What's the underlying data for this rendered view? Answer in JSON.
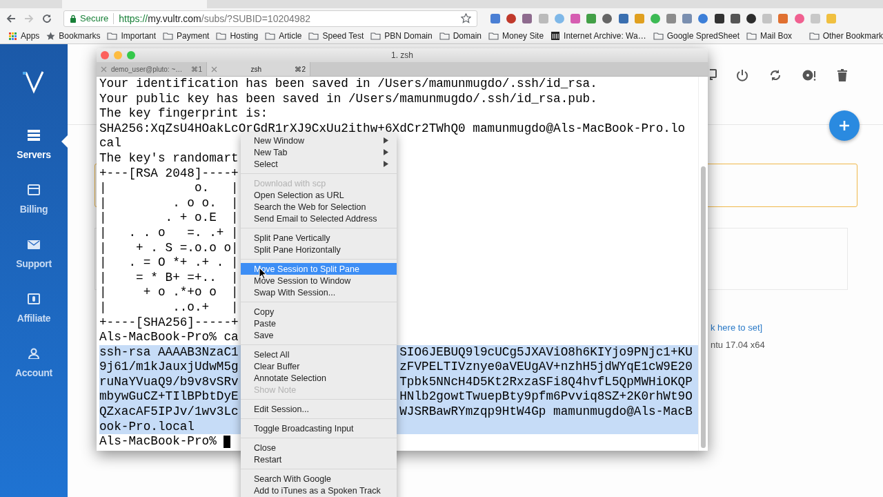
{
  "browser": {
    "address_bar": {
      "security_label": "Secure",
      "url_scheme": "https://",
      "url_host": "my.vultr.com",
      "url_path": "/subs/?SUBID=10204982"
    },
    "bookmarks": [
      {
        "label": "Apps",
        "kind": "apps"
      },
      {
        "label": "Bookmarks",
        "kind": "star"
      },
      {
        "label": "Important",
        "kind": "folder"
      },
      {
        "label": "Payment",
        "kind": "folder"
      },
      {
        "label": "Hosting",
        "kind": "folder"
      },
      {
        "label": "Article",
        "kind": "folder"
      },
      {
        "label": "Speed Test",
        "kind": "folder"
      },
      {
        "label": "PBN Domain",
        "kind": "folder"
      },
      {
        "label": "Domain",
        "kind": "folder"
      },
      {
        "label": "Money Site",
        "kind": "folder"
      },
      {
        "label": "Internet Archive: Wa…",
        "kind": "archive"
      },
      {
        "label": "Google SpredSheet",
        "kind": "folder"
      },
      {
        "label": "Mail Box",
        "kind": "folder"
      }
    ],
    "other_bookmarks": "Other Bookmark"
  },
  "sidebar": {
    "items": [
      {
        "label": "Servers",
        "kind": "servers",
        "selected": true
      },
      {
        "label": "Billing",
        "kind": "billing",
        "selected": false
      },
      {
        "label": "Support",
        "kind": "support",
        "selected": false
      },
      {
        "label": "Affiliate",
        "kind": "affiliate",
        "selected": false
      },
      {
        "label": "Account",
        "kind": "account",
        "selected": false
      }
    ]
  },
  "page": {
    "link_text": "k here to set]",
    "os_text": "ntu 17.04 x64"
  },
  "terminal": {
    "title": "1. zsh",
    "tabs": [
      {
        "label": "demo_user@pluto: ~…",
        "shortcut": "⌘1",
        "selected": false
      },
      {
        "label": "zsh",
        "shortcut": "⌘2",
        "selected": true
      }
    ],
    "lines": [
      {
        "text": "Your identification has been saved in /Users/mamunmugdo/.ssh/id_rsa.",
        "selected": false
      },
      {
        "text": "Your public key has been saved in /Users/mamunmugdo/.ssh/id_rsa.pub.",
        "selected": false
      },
      {
        "text": "The key fingerprint is:",
        "selected": false
      },
      {
        "text": "SHA256:XqZsU4HOakLcOrGdR1rXJ9CxUu2ithw+6XdCr2TWhQ0 mamunmugdo@Als-MacBook-Pro.lo",
        "selected": false
      },
      {
        "text": "cal",
        "selected": false
      },
      {
        "text": "The key's randomart",
        "selected": false
      },
      {
        "text": "+---[RSA 2048]----+",
        "selected": false
      },
      {
        "text": "|            o.   |",
        "selected": false
      },
      {
        "text": "|         . o o.  |",
        "selected": false
      },
      {
        "text": "|        . + o.E  |",
        "selected": false
      },
      {
        "text": "|   . . o   =. .+ |",
        "selected": false
      },
      {
        "text": "|    + . S =.o.o o|",
        "selected": false
      },
      {
        "text": "|   . = O *+ .+ . |",
        "selected": false
      },
      {
        "text": "|    = * B+ =+..  |",
        "selected": false
      },
      {
        "text": "|     + o .*+o o  |",
        "selected": false
      },
      {
        "text": "|         ..o.+   |",
        "selected": false
      },
      {
        "text": "+----[SHA256]-----+",
        "selected": false
      },
      {
        "text": "Als-MacBook-Pro% ca",
        "selected": false
      },
      {
        "text": "ssh-rsa AAAAB3NzaC1",
        "right": "SIO6JEBUQ9l9cUCg5JXAViO8h6KIYjo9PNjc1+KU",
        "selected": true
      },
      {
        "text": "9j61/m1kJauxjUdwM5g",
        "right": "zFVPELTIVznye0aVEUgAV+nzhH5jdWYqE1cW9E20",
        "selected": true
      },
      {
        "text": "ruNaYVuaQ9/b9v8vSRv",
        "right": "Tpbk5NNcH4D5Kt2RxzaSFi8Q4hvfL5QpMWHiOKQP",
        "selected": true
      },
      {
        "text": "mbywGuCZ+TIlBPbtDyE",
        "right": "HNlb2gowtTwuepBty9pfm6Pvviq8SZ+2K0rhWt9O",
        "selected": true
      },
      {
        "text": "QZxacAF5IPJv/1wv3Lc",
        "right": "WJSRBawRYmzqp9HtW4Gp mamunmugdo@Als-MacB",
        "selected": true
      },
      {
        "text": "ook-Pro.local",
        "selected": true
      },
      {
        "text": "Als-MacBook-Pro% ",
        "selected": false,
        "cursor": true
      }
    ]
  },
  "context_menu": {
    "sections": [
      {
        "items": [
          {
            "label": "New Window",
            "submenu": true,
            "disabled": false,
            "selected": false
          },
          {
            "label": "New Tab",
            "submenu": true,
            "disabled": false,
            "selected": false
          },
          {
            "label": "Select",
            "submenu": true,
            "disabled": false,
            "selected": false
          }
        ]
      },
      {
        "items": [
          {
            "label": "Download with scp",
            "submenu": false,
            "disabled": true,
            "selected": false
          },
          {
            "label": "Open Selection as URL",
            "submenu": false,
            "disabled": false,
            "selected": false
          },
          {
            "label": "Search the Web for Selection",
            "submenu": false,
            "disabled": false,
            "selected": false
          },
          {
            "label": "Send Email to Selected Address",
            "submenu": false,
            "disabled": false,
            "selected": false
          }
        ]
      },
      {
        "items": [
          {
            "label": "Split Pane Vertically",
            "submenu": false,
            "disabled": false,
            "selected": false
          },
          {
            "label": "Split Pane Horizontally",
            "submenu": false,
            "disabled": false,
            "selected": false
          }
        ]
      },
      {
        "items": [
          {
            "label": "Move Session to Split Pane",
            "submenu": false,
            "disabled": false,
            "selected": true
          },
          {
            "label": "Move Session to Window",
            "submenu": false,
            "disabled": false,
            "selected": false
          },
          {
            "label": "Swap With Session...",
            "submenu": false,
            "disabled": false,
            "selected": false
          }
        ]
      },
      {
        "items": [
          {
            "label": "Copy",
            "submenu": false,
            "disabled": false,
            "selected": false
          },
          {
            "label": "Paste",
            "submenu": false,
            "disabled": false,
            "selected": false
          },
          {
            "label": "Save",
            "submenu": false,
            "disabled": false,
            "selected": false
          }
        ]
      },
      {
        "items": [
          {
            "label": "Select All",
            "submenu": false,
            "disabled": false,
            "selected": false
          },
          {
            "label": "Clear Buffer",
            "submenu": false,
            "disabled": false,
            "selected": false
          },
          {
            "label": "Annotate Selection",
            "submenu": false,
            "disabled": false,
            "selected": false
          },
          {
            "label": "Show Note",
            "submenu": false,
            "disabled": true,
            "selected": false
          }
        ]
      },
      {
        "items": [
          {
            "label": "Edit Session...",
            "submenu": false,
            "disabled": false,
            "selected": false
          }
        ]
      },
      {
        "items": [
          {
            "label": "Toggle Broadcasting Input",
            "submenu": false,
            "disabled": false,
            "selected": false
          }
        ]
      },
      {
        "items": [
          {
            "label": "Close",
            "submenu": false,
            "disabled": false,
            "selected": false
          },
          {
            "label": "Restart",
            "submenu": false,
            "disabled": false,
            "selected": false
          }
        ]
      },
      {
        "items": [
          {
            "label": "Search With Google",
            "submenu": false,
            "disabled": false,
            "selected": false
          },
          {
            "label": "Add to iTunes as a Spoken Track",
            "submenu": false,
            "disabled": false,
            "selected": false
          }
        ]
      }
    ]
  }
}
